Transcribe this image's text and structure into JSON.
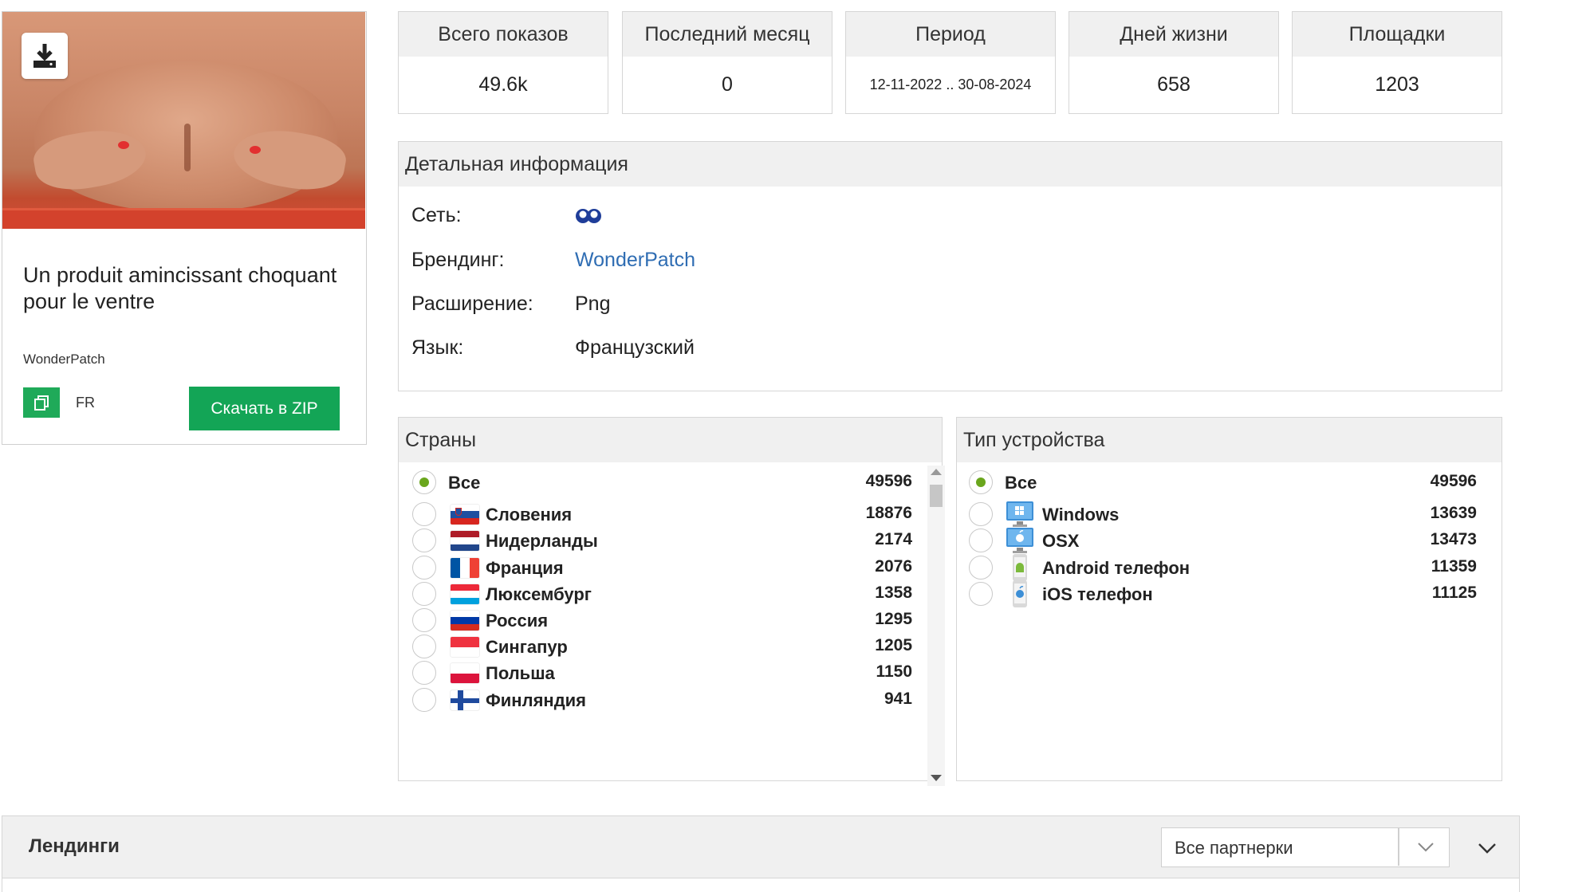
{
  "ad": {
    "title": "Un produit amincissant choquant pour le ventre",
    "brand": "WonderPatch",
    "lang": "FR",
    "zip_button": "Скачать в ZIP"
  },
  "stats": [
    {
      "label": "Всего показов",
      "value": "49.6k"
    },
    {
      "label": "Последний месяц",
      "value": "0"
    },
    {
      "label": "Период",
      "value": "12-11-2022 .. 30-08-2024"
    },
    {
      "label": "Дней жизни",
      "value": "658"
    },
    {
      "label": "Площадки",
      "value": "1203"
    }
  ],
  "details": {
    "title": "Детальная информация",
    "network_label": "Сеть:",
    "network_icon": "network-logo-icon",
    "branding_label": "Брендинг:",
    "branding_value": "WonderPatch",
    "extension_label": "Расширение:",
    "extension_value": "Png",
    "language_label": "Язык:",
    "language_value": "Французский"
  },
  "countries": {
    "title": "Страны",
    "items": [
      {
        "name": "Все",
        "count": "49596",
        "selected": true,
        "flag": "none"
      },
      {
        "name": "Словения",
        "count": "18876",
        "flag": "si"
      },
      {
        "name": "Нидерланды",
        "count": "2174",
        "flag": "nl"
      },
      {
        "name": "Франция",
        "count": "2076",
        "flag": "fr"
      },
      {
        "name": "Люксембург",
        "count": "1358",
        "flag": "lu"
      },
      {
        "name": "Россия",
        "count": "1295",
        "flag": "ru"
      },
      {
        "name": "Сингапур",
        "count": "1205",
        "flag": "sg"
      },
      {
        "name": "Польша",
        "count": "1150",
        "flag": "pl"
      },
      {
        "name": "Финляндия",
        "count": "941",
        "flag": "fi"
      }
    ]
  },
  "devices": {
    "title": "Тип устройства",
    "items": [
      {
        "name": "Все",
        "count": "49596",
        "selected": true,
        "icon": "none"
      },
      {
        "name": "Windows",
        "count": "13639",
        "icon": "windows-icon"
      },
      {
        "name": "OSX",
        "count": "13473",
        "icon": "apple-monitor-icon"
      },
      {
        "name": "Android телефон",
        "count": "11359",
        "icon": "android-phone-icon"
      },
      {
        "name": "iOS телефон",
        "count": "11125",
        "icon": "ios-phone-icon"
      }
    ]
  },
  "landings": {
    "title": "Лендинги",
    "select_value": "Все партнерки"
  },
  "colors": {
    "accent_green": "#13a556",
    "radio_green": "#6aa61d",
    "link_blue": "#2f6db3",
    "header_gray": "#f0f0f0"
  }
}
